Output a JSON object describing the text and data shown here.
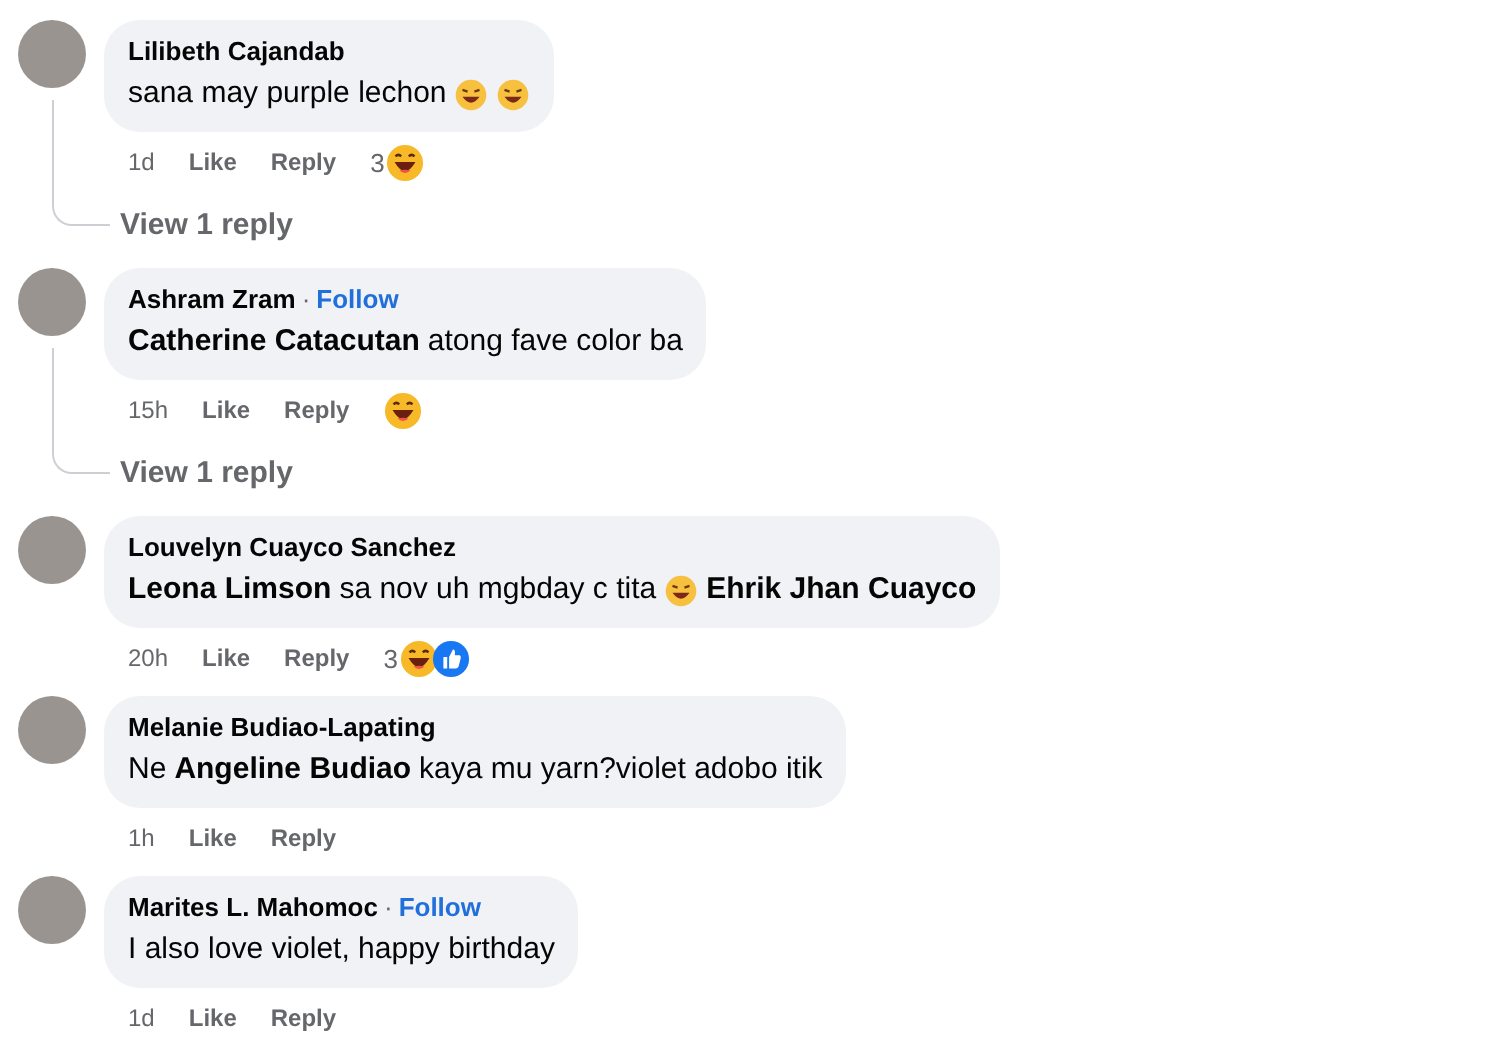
{
  "comments": [
    {
      "author": "Lilibeth Cajandab",
      "body": [
        {
          "kind": "text",
          "text": "sana may purple lechon"
        },
        {
          "kind": "emoji"
        },
        {
          "kind": "emoji"
        }
      ],
      "time": "1d",
      "like": "Like",
      "reply": "Reply",
      "reactions": {
        "count": "3",
        "icons": [
          {
            "kind": "haha"
          }
        ]
      },
      "view_replies": "View 1 reply"
    },
    {
      "author": "Ashram Zram",
      "follow": {
        "dot": "·",
        "label": "Follow"
      },
      "body": [
        {
          "kind": "mention",
          "text": "Catherine Catacutan"
        },
        {
          "kind": "text",
          "text": "atong fave color ba"
        }
      ],
      "time": "15h",
      "like": "Like",
      "reply": "Reply",
      "reactions": {
        "icons": [
          {
            "kind": "haha"
          }
        ]
      },
      "view_replies": "View 1 reply"
    },
    {
      "author": "Louvelyn Cuayco Sanchez",
      "body": [
        {
          "kind": "mention",
          "text": "Leona Limson"
        },
        {
          "kind": "text",
          "text": "sa nov uh mgbday c tita"
        },
        {
          "kind": "emoji"
        },
        {
          "kind": "mention",
          "text": "Ehrik Jhan Cuayco"
        }
      ],
      "time": "20h",
      "like": "Like",
      "reply": "Reply",
      "reactions": {
        "count": "3",
        "icons": [
          {
            "kind": "haha"
          },
          {
            "kind": "like"
          }
        ]
      }
    },
    {
      "author": "Melanie Budiao-Lapating",
      "body": [
        {
          "kind": "text",
          "text": "Ne"
        },
        {
          "kind": "mention",
          "text": "Angeline Budiao"
        },
        {
          "kind": "text",
          "text": "kaya mu yarn?violet adobo itik"
        }
      ],
      "time": "1h",
      "like": "Like",
      "reply": "Reply"
    },
    {
      "author": "Marites L. Mahomoc",
      "follow": {
        "dot": "·",
        "label": "Follow"
      },
      "body": [
        {
          "kind": "text",
          "text": "I also love violet, happy birthday"
        }
      ],
      "time": "1d",
      "like": "Like",
      "reply": "Reply"
    }
  ]
}
